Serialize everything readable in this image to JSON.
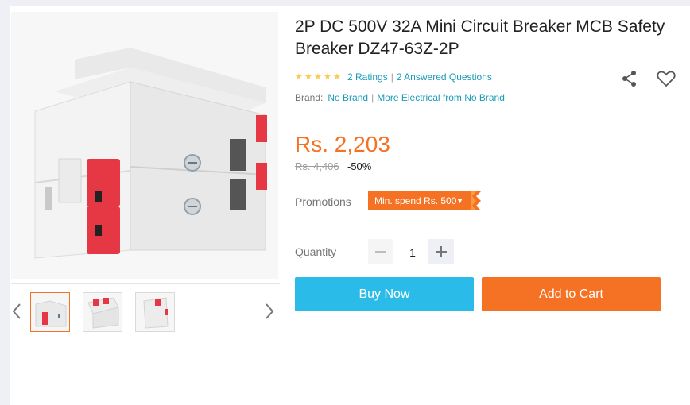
{
  "product": {
    "title": "2P DC 500V 32A Mini Circuit Breaker MCB Safety Breaker DZ47-63Z-2P",
    "ratings_text": "2 Ratings",
    "questions_text": "2 Answered Questions",
    "rating_stars": 5,
    "brand_label": "Brand:",
    "brand_name": "No Brand",
    "more_from_brand": "More Electrical from No Brand",
    "price": "Rs. 2,203",
    "original_price": "Rs. 4,406",
    "discount": "-50%"
  },
  "promotions": {
    "label": "Promotions",
    "tag": "Min. spend Rs. 500"
  },
  "quantity": {
    "label": "Quantity",
    "value": "1"
  },
  "actions": {
    "buy_now": "Buy Now",
    "add_to_cart": "Add to Cart"
  },
  "colors": {
    "accent_orange": "#f57224",
    "buy_blue": "#2abbe8",
    "link_blue": "#1a9cb7",
    "star_yellow": "#faca51"
  },
  "icons": [
    "share-icon",
    "heart-icon",
    "chevron-left-icon",
    "chevron-right-icon",
    "minus-icon",
    "plus-icon",
    "star-icon",
    "dropdown-arrow-icon"
  ]
}
